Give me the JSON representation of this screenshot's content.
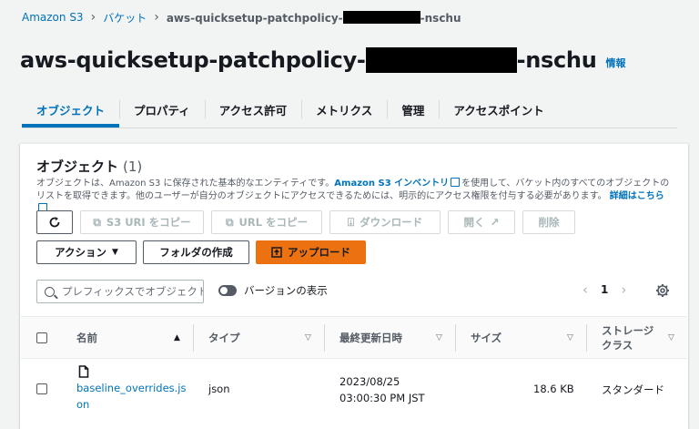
{
  "breadcrumb": {
    "root": "Amazon S3",
    "buckets": "バケット",
    "current_prefix": "aws-quicksetup-patchpolicy-",
    "current_suffix": "-nschu"
  },
  "header": {
    "title_prefix": "aws-quicksetup-patchpolicy-",
    "title_suffix": "-nschu",
    "info": "情報"
  },
  "tabs": [
    {
      "label": "オブジェクト",
      "active": true
    },
    {
      "label": "プロパティ"
    },
    {
      "label": "アクセス許可"
    },
    {
      "label": "メトリクス"
    },
    {
      "label": "管理"
    },
    {
      "label": "アクセスポイント"
    }
  ],
  "panel": {
    "title": "オブジェクト",
    "count": "(1)",
    "desc_1": "オブジェクトは、Amazon S3 に保存された基本的なエンティティです。",
    "desc_link_1": "Amazon S3 インベントリ",
    "desc_2": "を使用して、バケット内のすべてのオブジェクトのリストを取得できます。他のユーザーが自分のオブジェクトにアクセスできるためには、明示的にアクセス権限を付与する必要があります。",
    "desc_link_2": "詳細はこちら"
  },
  "toolbar": {
    "refresh_icon": "refresh-icon",
    "copy_s3_uri": "S3 URI をコピー",
    "copy_url": "URL をコピー",
    "download": "ダウンロード",
    "open": "開く",
    "delete": "削除",
    "actions": "アクション",
    "create_folder": "フォルダの作成",
    "upload": "アップロード"
  },
  "search": {
    "placeholder": "プレフィックスでオブジェクトを検索"
  },
  "versions_toggle": "バージョンの表示",
  "pagination": {
    "page": "1"
  },
  "table": {
    "columns": {
      "name": "名前",
      "type": "タイプ",
      "modified": "最終更新日時",
      "size": "サイズ",
      "storage_1": "ストレージ",
      "storage_2": "クラス"
    },
    "rows": [
      {
        "name_1": "baseline_overrides.js",
        "name_2": "on",
        "type": "json",
        "date": "2023/08/25",
        "time": "03:00:30 PM JST",
        "size": "18.6 KB",
        "storage": "スタンダード"
      }
    ]
  },
  "colors": {
    "accent": "#0073bb",
    "primary": "#ec7211"
  }
}
